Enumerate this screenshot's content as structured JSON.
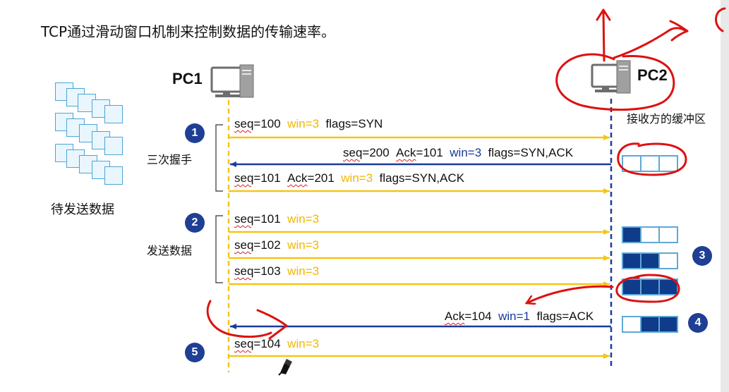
{
  "title": "TCP通过滑动窗口机制来控制数据的传输速率。",
  "hosts": {
    "sender": "PC1",
    "receiver": "PC2",
    "receiver_buffer_label": "接收方的缓冲区"
  },
  "sender_data_label": "待发送数据",
  "phases": {
    "handshake": "三次握手",
    "send": "发送数据"
  },
  "steps": [
    "1",
    "2",
    "3",
    "4",
    "5"
  ],
  "messages": {
    "m1": {
      "seq": "seq",
      "seq_rest": "=100",
      "win": "win=3",
      "flags": "flags=SYN"
    },
    "m2": {
      "seq": "seq",
      "seq_rest": "=200",
      "ack": "Ack",
      "ack_rest": "=101",
      "win": "win=3",
      "flags": "flags=SYN,ACK"
    },
    "m3": {
      "seq": "seq",
      "seq_rest": "=101",
      "ack": "Ack",
      "ack_rest": "=201",
      "win": "win=3",
      "flags": "flags=SYN,ACK"
    },
    "m4": {
      "seq": "seq",
      "seq_rest": "=101",
      "win": "win=3"
    },
    "m5": {
      "seq": "seq",
      "seq_rest": "=102",
      "win": "win=3"
    },
    "m6": {
      "seq": "seq",
      "seq_rest": "=103",
      "win": "win=3"
    },
    "m7": {
      "ack": "Ack",
      "ack_rest": "=104",
      "win": "win=1",
      "flags": "flags=ACK"
    },
    "m8": {
      "seq": "seq",
      "seq_rest": "=104",
      "win": "win=3"
    }
  },
  "buffers": [
    {
      "filled": 0,
      "capacity": 3
    },
    {
      "filled": 1,
      "capacity": 3
    },
    {
      "filled": 2,
      "capacity": 3
    },
    {
      "filled": 3,
      "capacity": 3
    },
    {
      "filled": 2,
      "capacity": 3
    }
  ],
  "colors": {
    "timeline_pc1": "#f5c518",
    "timeline_pc2": "#1a3a9c",
    "arrow_to_pc2": "#f5c518",
    "arrow_to_pc1": "#1a3a9c",
    "step_badge": "#1f3f95",
    "buffer_fill": "#0e3b8a",
    "buffer_border": "#5fa8d6",
    "handwriting": "#dd1111",
    "win_sender": "#f2b600",
    "win_receiver": "#1a3a9c"
  },
  "icons": [
    "computer-icon",
    "document-stack-icon",
    "pen-cursor-icon"
  ]
}
